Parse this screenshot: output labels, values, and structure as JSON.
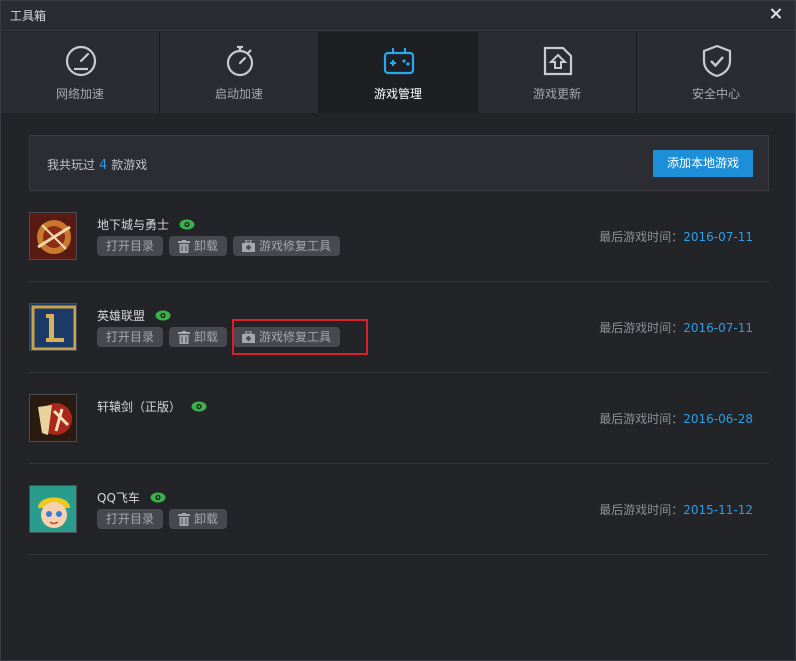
{
  "window": {
    "title": "工具箱"
  },
  "colors": {
    "accent": "#1d8ed8",
    "link": "#2a9ee6",
    "eye": "#39b34a",
    "highlight": "#d8222b"
  },
  "tabs": [
    {
      "label": "网络加速",
      "icon": "speedometer-icon",
      "active": false
    },
    {
      "label": "启动加速",
      "icon": "stopwatch-icon",
      "active": false
    },
    {
      "label": "游戏管理",
      "icon": "gamepad-icon",
      "active": true
    },
    {
      "label": "游戏更新",
      "icon": "update-folder-icon",
      "active": false
    },
    {
      "label": "安全中心",
      "icon": "shield-check-icon",
      "active": false
    }
  ],
  "summary": {
    "prefix": "我共玩过",
    "count": "4",
    "suffix": "款游戏",
    "add_button": "添加本地游戏"
  },
  "actions": {
    "open_dir": "打开目录",
    "uninstall": "卸载",
    "repair": "游戏修复工具"
  },
  "last_played_label": "最后游戏时间：",
  "games": [
    {
      "name": "地下城与勇士",
      "date": "2016-07-11",
      "icon": "dnf-game-icon"
    },
    {
      "name": "英雄联盟",
      "date": "2016-07-11",
      "icon": "lol-game-icon"
    },
    {
      "name": "轩辕剑（正版）",
      "date": "2016-06-28",
      "icon": "xuanyuan-game-icon"
    },
    {
      "name": "QQ飞车",
      "date": "2015-11-12",
      "icon": "qqspeed-game-icon"
    }
  ]
}
